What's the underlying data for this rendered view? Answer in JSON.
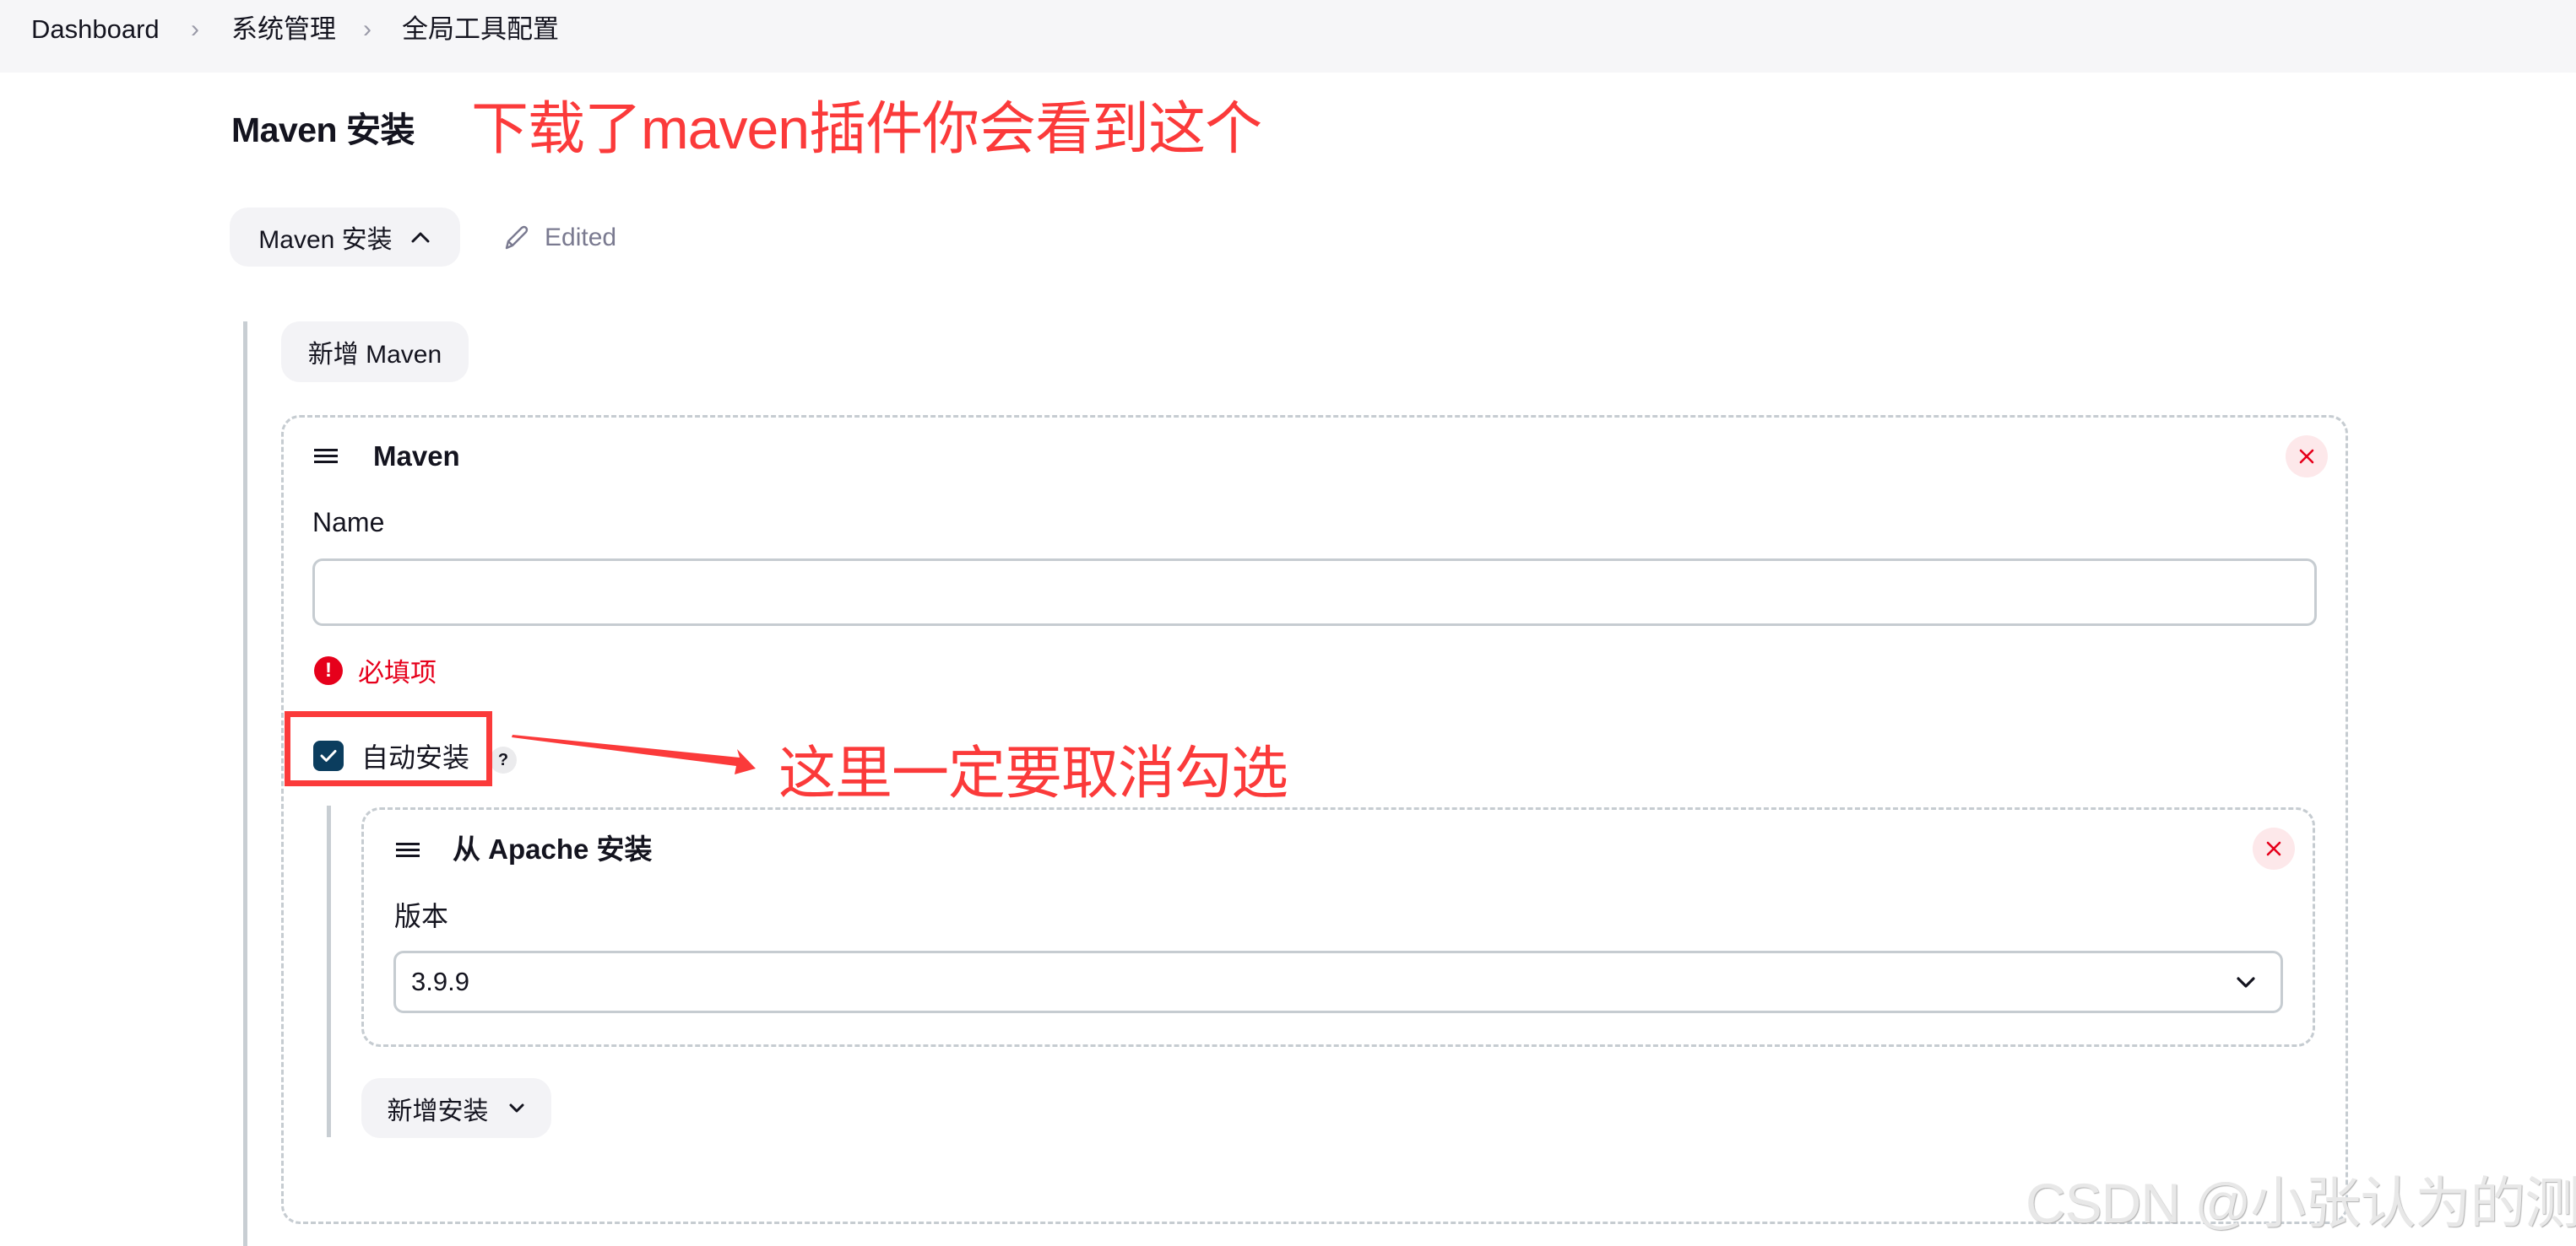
{
  "breadcrumb": {
    "items": [
      "Dashboard",
      "系统管理",
      "全局工具配置"
    ],
    "separator": "›"
  },
  "section": {
    "title": "Maven 安装",
    "toggle_label": "Maven 安装",
    "edited_label": "Edited",
    "add_button_label": "新增 Maven"
  },
  "annotations": {
    "top_note": "下载了maven插件你会看到这个",
    "checkbox_note": "这里一定要取消勾选",
    "color": "#fb3a3a"
  },
  "maven_card": {
    "title": "Maven",
    "name_label": "Name",
    "name_value": "",
    "name_placeholder": "",
    "error_text": "必填项",
    "auto_install_label": "自动安装",
    "auto_install_checked": true,
    "help_label": "?",
    "installer": {
      "title": "从 Apache 安装",
      "version_label": "版本",
      "version_selected": "3.9.9"
    },
    "add_installer_label": "新增安装"
  },
  "watermark": "CSDN @小张认为的测试",
  "colors": {
    "error": "#e6001b",
    "checkbox": "#0b3d5e",
    "close_bg": "#fde8ea",
    "border": "#c6ccd1"
  }
}
